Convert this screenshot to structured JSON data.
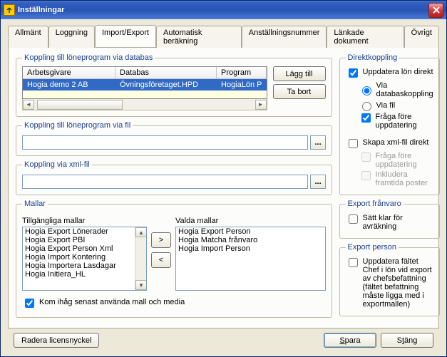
{
  "window": {
    "title": "Inställningar"
  },
  "tabs": [
    "Allmänt",
    "Loggning",
    "Import/Export",
    "Automatisk beräkning",
    "Anställningsnummer",
    "Länkade dokument",
    "Övrigt"
  ],
  "active_tab_index": 2,
  "db_section": {
    "legend": "Koppling till löneprogram via databas",
    "headers": [
      "Arbetsgivare",
      "Databas",
      "Program"
    ],
    "row": [
      "Hogia demo 2 AB",
      "Övningsföretaget.HPD",
      "HogiaLön P"
    ],
    "add_button": "Lägg till",
    "remove_button": "Ta bort"
  },
  "file_section": {
    "legend": "Koppling till löneprogram via fil",
    "value": ""
  },
  "xml_section": {
    "legend": "Koppling via xml-fil",
    "value": ""
  },
  "templates": {
    "legend": "Mallar",
    "available_label": "Tillgängliga mallar",
    "selected_label": "Valda mallar",
    "available": [
      "Hogia Export Lönerader",
      "Hogia Export PBI",
      "Hogia Export Person Xml",
      "Hogia Import Kontering",
      "Hogia Importera Lasdagar",
      "Hogia Initiera_HL"
    ],
    "selected": [
      "Hogia Export Person",
      "Hogia Matcha frånvaro",
      "Hogia Import Person"
    ],
    "remember_label": "Kom ihåg senast använda mall och media"
  },
  "direct": {
    "legend": "Direktkoppling",
    "update_label": "Uppdatera lön direkt",
    "via_db": "Via databaskoppling",
    "via_file": "Via fil",
    "ask_label": "Fråga före uppdatering",
    "create_xml": "Skapa xml-fil direkt",
    "ask_xml": "Fråga före uppdatering",
    "include_future": "Inkludera framtida poster"
  },
  "export_absence": {
    "legend": "Export frånvaro",
    "set_ready": "Sätt klar för avräkning"
  },
  "export_person": {
    "legend": "Export person",
    "chef_label": "Uppdatera fältet Chef i lön vid export av chefsbefattning",
    "chef_note": "(fältet befattning måste ligga med i exportmallen)"
  },
  "footer": {
    "delete_license": "Radera licensnyckel",
    "save": "Spara",
    "close": "Stäng"
  },
  "browse_glyph": "..."
}
